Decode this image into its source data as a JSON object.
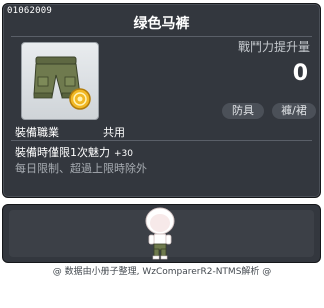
{
  "item": {
    "id": "01062009",
    "name": "绿色马裤",
    "stat_label": "戰鬥力提升量",
    "stat_value": "0",
    "tag_type": "防具",
    "tag_subtype": "褲/裙",
    "job_label": "裝備職業",
    "job_value": "共用",
    "desc_main": "裝備時僅限1次魅力",
    "desc_bonus": "+30",
    "desc_note": "每日限制、超過上限時除外"
  },
  "footer": {
    "text": "@ 数据由小册子整理, WzComparerR2-NTMS解析 @"
  },
  "colors": {
    "panel": "#33373e",
    "pants": "#6f7a4e",
    "coin": "#f2b824"
  },
  "icons": {
    "item_icon": "olive-cargo-pants-icon",
    "badge": "gold-coin-icon",
    "character": "character-preview"
  }
}
